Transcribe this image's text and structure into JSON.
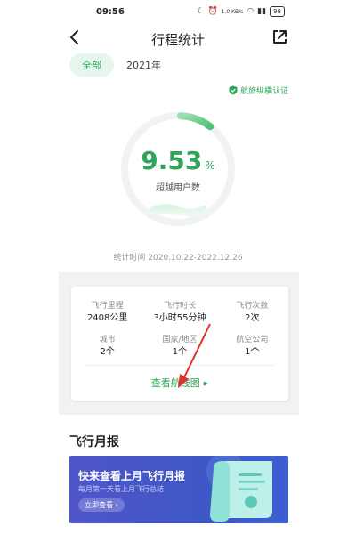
{
  "status_bar": {
    "time": "09:56",
    "speed": "1.0 KB/s",
    "battery": "98"
  },
  "header": {
    "title": "行程统计"
  },
  "filters": {
    "all": "全部",
    "year": "2021年"
  },
  "certification": "航旅纵横认证",
  "summary": {
    "percent": "9.53",
    "unit": "%",
    "label": "超越用户数",
    "progress_fraction": 0.0953
  },
  "stat_time": "统计时间 2020.10.22-2022.12.26",
  "stats": [
    {
      "label": "飞行里程",
      "value": "2408公里"
    },
    {
      "label": "飞行时长",
      "value": "3小时55分钟"
    },
    {
      "label": "飞行次数",
      "value": "2次"
    },
    {
      "label": "城市",
      "value": "2个"
    },
    {
      "label": "国家/地区",
      "value": "1个"
    },
    {
      "label": "航空公司",
      "value": "1个"
    }
  ],
  "route_link": "查看航线图",
  "monthly": {
    "section_title": "飞行月报",
    "banner_title": "快来查看上月飞行月报",
    "banner_subtitle": "每月第一天看上月飞行总结",
    "banner_button": "立即查看"
  },
  "colors": {
    "accent": "#2ea55a",
    "banner": "#4f56c9",
    "annotation": "#e0302a"
  }
}
